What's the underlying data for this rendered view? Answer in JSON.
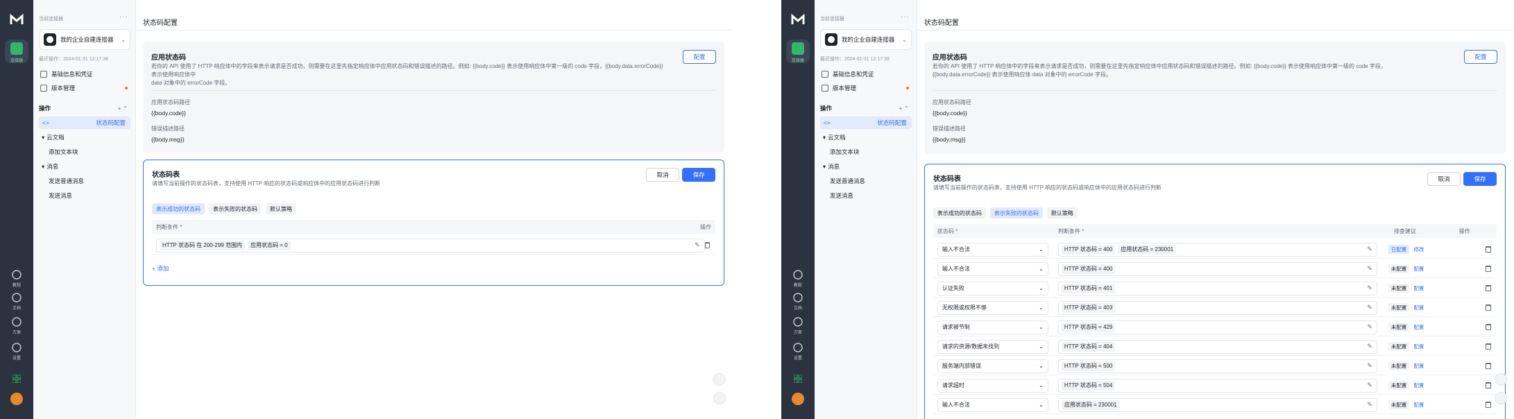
{
  "rail": {
    "app_label": "连接器",
    "links": [
      "教程",
      "文档",
      "方案",
      "设置"
    ]
  },
  "sidebar": {
    "current_label": "当前连接器",
    "connector_name": "我的企业自建连接器",
    "last_op": "最近操作：2024-01-31 12:17:38",
    "items": [
      "基础信息和凭证",
      "版本管理"
    ],
    "ops_title": "操作",
    "ops": [
      "状态码配置",
      "云文档",
      "添加文本块",
      "消息",
      "发送普通消息",
      "发送消息"
    ]
  },
  "main": {
    "title": "状态码配置",
    "app_status": {
      "title": "应用状态码",
      "desc_line1": "若你的 API 使用了 HTTP 响应体中的字段来表示请求是否成功，则需要在这里先指定响应体中应用状态码和错误描述的路径。例如: {{body.code}} 表示使用响应体中第一级的 code 字段，{{body.data.errorCode}} 表示使用响应体中",
      "desc_line2": "data 对象中的 errorCode 字段。",
      "desc_line1_r": "若你的 API 使用了 HTTP 响应体中的字段来表示请求是否成功，则需要在这里先指定响应体中应用状态码和错误描述的路径。例如: {{body.code}} 表示使用响应体中第一级的 code 字段，",
      "desc_line2_r": "{{body.data.errorCode}} 表示使用响应体 data 对象中的 errorCode 字段。",
      "config": "配置",
      "code_path_label": "应用状态码路径",
      "code_path_value": "{{body.code}}",
      "msg_path_label": "错误描述路径",
      "msg_path_value": "{{body.msg}}"
    },
    "status_table": {
      "title": "状态码表",
      "desc": "请填写当前操作的状态码表，支持使用 HTTP 响应的状态码或响应体中的应用状态码进行判断",
      "cancel": "取消",
      "save": "保存",
      "tabs": [
        "表示成功的状态码",
        "表示失败的状态码",
        "默认策略"
      ],
      "left_col_cond": "判断条件 *",
      "left_col_op": "操作",
      "left_row": [
        "HTTP 状态码 在 200-299 范围内",
        "应用状态码 = 0"
      ],
      "add": "+ 添加",
      "cols": [
        "状态码 *",
        "判断条件 *",
        "排查建议",
        "操作"
      ],
      "rows": [
        {
          "code": "输入不合法",
          "conds": [
            "HTTP 状态码 = 400",
            "应用状态码 = 230001"
          ],
          "tip": "已配置",
          "act": "修改"
        },
        {
          "code": "输入不合法",
          "conds": [
            "HTTP 状态码 = 400"
          ],
          "tip": "未配置",
          "act": "配置"
        },
        {
          "code": "认证失败",
          "conds": [
            "HTTP 状态码 = 401"
          ],
          "tip": "未配置",
          "act": "配置"
        },
        {
          "code": "无权限或权限不够",
          "conds": [
            "HTTP 状态码 = 403"
          ],
          "tip": "未配置",
          "act": "配置"
        },
        {
          "code": "请求被节制",
          "conds": [
            "HTTP 状态码 = 429"
          ],
          "tip": "未配置",
          "act": "配置"
        },
        {
          "code": "请求的资源/数据未找到",
          "conds": [
            "HTTP 状态码 = 404"
          ],
          "tip": "未配置",
          "act": "配置"
        },
        {
          "code": "服务端内部错误",
          "conds": [
            "HTTP 状态码 = 500"
          ],
          "tip": "未配置",
          "act": "配置"
        },
        {
          "code": "请求超时",
          "conds": [
            "HTTP 状态码 = 504"
          ],
          "tip": "未配置",
          "act": "配置"
        },
        {
          "code": "输入不合法",
          "conds": [
            "应用状态码 = 230001"
          ],
          "tip": "未配置",
          "act": "配置"
        }
      ]
    }
  }
}
